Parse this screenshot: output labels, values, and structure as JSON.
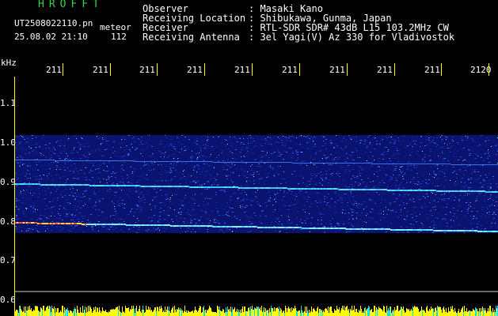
{
  "header": {
    "brand": "HROFFT",
    "file_name": "UT2508022110.pn",
    "file_suffix": "meteor",
    "datetime": "25.08.02 21:10",
    "count": "112"
  },
  "metadata": [
    {
      "label": "Observer",
      "value": ": Masaki Kano"
    },
    {
      "label": "Receiving Location",
      "value": ": Shibukawa, Gunma, Japan"
    },
    {
      "label": "Receiver",
      "value": ": RTL-SDR SDR# 43dB L15 103.2MHz CW"
    },
    {
      "label": "Receiving Antenna",
      "value": ": 3el Yagi(V) Az 330 for Vladivostok"
    }
  ],
  "time_axis": {
    "labels": [
      "211",
      "211",
      "211",
      "211",
      "211",
      "211",
      "211",
      "211",
      "211",
      "2120"
    ]
  },
  "freq_axis": {
    "unit": "kHz",
    "ticks": [
      "1.1",
      "1.0",
      "0.9",
      "0.8",
      "0.7",
      "0.6"
    ]
  },
  "colors": {
    "accent": "#ffff00",
    "brand": "#2fd84a",
    "background": "#000000"
  }
}
